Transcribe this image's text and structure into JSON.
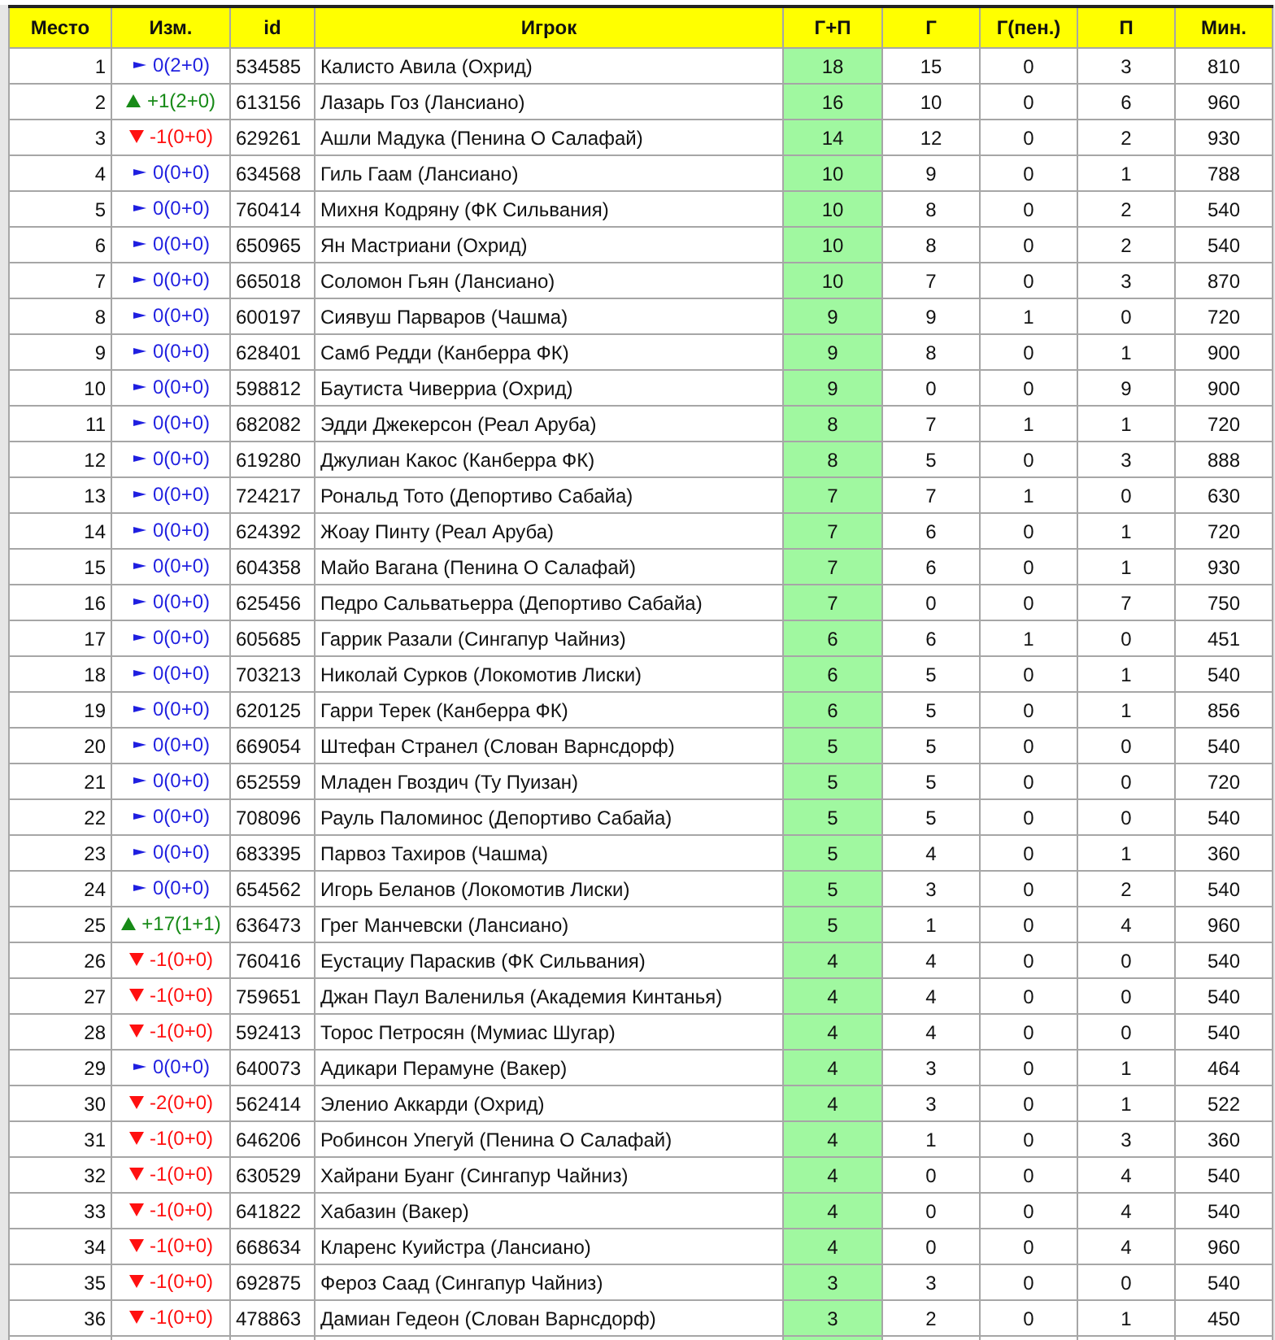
{
  "table": {
    "columns": [
      "Место",
      "Изм.",
      "id",
      "Игрок",
      "Г+П",
      "Г",
      "Г(пен.)",
      "П",
      "Мин."
    ],
    "rows": [
      {
        "place": "1",
        "change": {
          "kind": "flat",
          "text": "0(2+0)"
        },
        "id": "534585",
        "player": "Калисто Авила (Охрид)",
        "goals_assists": "18",
        "goals": "15",
        "penalty_goals": "0",
        "assists": "3",
        "minutes": "810"
      },
      {
        "place": "2",
        "change": {
          "kind": "up",
          "text": "+1(2+0)"
        },
        "id": "613156",
        "player": "Лазарь Гоз (Лансиано)",
        "goals_assists": "16",
        "goals": "10",
        "penalty_goals": "0",
        "assists": "6",
        "minutes": "960"
      },
      {
        "place": "3",
        "change": {
          "kind": "down",
          "text": "-1(0+0)"
        },
        "id": "629261",
        "player": "Ашли Мадука (Пенина О Салафай)",
        "goals_assists": "14",
        "goals": "12",
        "penalty_goals": "0",
        "assists": "2",
        "minutes": "930"
      },
      {
        "place": "4",
        "change": {
          "kind": "flat",
          "text": "0(0+0)"
        },
        "id": "634568",
        "player": "Гиль Гаам (Лансиано)",
        "goals_assists": "10",
        "goals": "9",
        "penalty_goals": "0",
        "assists": "1",
        "minutes": "788"
      },
      {
        "place": "5",
        "change": {
          "kind": "flat",
          "text": "0(0+0)"
        },
        "id": "760414",
        "player": "Михня Кодряну (ФК Сильвания)",
        "goals_assists": "10",
        "goals": "8",
        "penalty_goals": "0",
        "assists": "2",
        "minutes": "540"
      },
      {
        "place": "6",
        "change": {
          "kind": "flat",
          "text": "0(0+0)"
        },
        "id": "650965",
        "player": "Ян Мастриани (Охрид)",
        "goals_assists": "10",
        "goals": "8",
        "penalty_goals": "0",
        "assists": "2",
        "minutes": "540"
      },
      {
        "place": "7",
        "change": {
          "kind": "flat",
          "text": "0(0+0)"
        },
        "id": "665018",
        "player": "Соломон Гьян (Лансиано)",
        "goals_assists": "10",
        "goals": "7",
        "penalty_goals": "0",
        "assists": "3",
        "minutes": "870"
      },
      {
        "place": "8",
        "change": {
          "kind": "flat",
          "text": "0(0+0)"
        },
        "id": "600197",
        "player": "Сиявуш Парваров (Чашма)",
        "goals_assists": "9",
        "goals": "9",
        "penalty_goals": "1",
        "assists": "0",
        "minutes": "720"
      },
      {
        "place": "9",
        "change": {
          "kind": "flat",
          "text": "0(0+0)"
        },
        "id": "628401",
        "player": "Самб Редди (Канберра ФК)",
        "goals_assists": "9",
        "goals": "8",
        "penalty_goals": "0",
        "assists": "1",
        "minutes": "900"
      },
      {
        "place": "10",
        "change": {
          "kind": "flat",
          "text": "0(0+0)"
        },
        "id": "598812",
        "player": "Баутиста Чиверриа (Охрид)",
        "goals_assists": "9",
        "goals": "0",
        "penalty_goals": "0",
        "assists": "9",
        "minutes": "900"
      },
      {
        "place": "11",
        "change": {
          "kind": "flat",
          "text": "0(0+0)"
        },
        "id": "682082",
        "player": "Эдди Джекерсон (Реал Аруба)",
        "goals_assists": "8",
        "goals": "7",
        "penalty_goals": "1",
        "assists": "1",
        "minutes": "720"
      },
      {
        "place": "12",
        "change": {
          "kind": "flat",
          "text": "0(0+0)"
        },
        "id": "619280",
        "player": "Джулиан Какос (Канберра ФК)",
        "goals_assists": "8",
        "goals": "5",
        "penalty_goals": "0",
        "assists": "3",
        "minutes": "888"
      },
      {
        "place": "13",
        "change": {
          "kind": "flat",
          "text": "0(0+0)"
        },
        "id": "724217",
        "player": "Рональд Тото (Депортиво Сабайа)",
        "goals_assists": "7",
        "goals": "7",
        "penalty_goals": "1",
        "assists": "0",
        "minutes": "630"
      },
      {
        "place": "14",
        "change": {
          "kind": "flat",
          "text": "0(0+0)"
        },
        "id": "624392",
        "player": "Жоау Пинту (Реал Аруба)",
        "goals_assists": "7",
        "goals": "6",
        "penalty_goals": "0",
        "assists": "1",
        "minutes": "720"
      },
      {
        "place": "15",
        "change": {
          "kind": "flat",
          "text": "0(0+0)"
        },
        "id": "604358",
        "player": "Майо Вагана (Пенина О Салафай)",
        "goals_assists": "7",
        "goals": "6",
        "penalty_goals": "0",
        "assists": "1",
        "minutes": "930"
      },
      {
        "place": "16",
        "change": {
          "kind": "flat",
          "text": "0(0+0)"
        },
        "id": "625456",
        "player": "Педро Сальватьерра (Депортиво Сабайа)",
        "goals_assists": "7",
        "goals": "0",
        "penalty_goals": "0",
        "assists": "7",
        "minutes": "750"
      },
      {
        "place": "17",
        "change": {
          "kind": "flat",
          "text": "0(0+0)"
        },
        "id": "605685",
        "player": "Гаррик Разали (Сингапур Чайниз)",
        "goals_assists": "6",
        "goals": "6",
        "penalty_goals": "1",
        "assists": "0",
        "minutes": "451"
      },
      {
        "place": "18",
        "change": {
          "kind": "flat",
          "text": "0(0+0)"
        },
        "id": "703213",
        "player": "Николай Сурков (Локомотив Лиски)",
        "goals_assists": "6",
        "goals": "5",
        "penalty_goals": "0",
        "assists": "1",
        "minutes": "540"
      },
      {
        "place": "19",
        "change": {
          "kind": "flat",
          "text": "0(0+0)"
        },
        "id": "620125",
        "player": "Гарри Терек (Канберра ФК)",
        "goals_assists": "6",
        "goals": "5",
        "penalty_goals": "0",
        "assists": "1",
        "minutes": "856"
      },
      {
        "place": "20",
        "change": {
          "kind": "flat",
          "text": "0(0+0)"
        },
        "id": "669054",
        "player": "Штефан Странел (Слован Варнсдорф)",
        "goals_assists": "5",
        "goals": "5",
        "penalty_goals": "0",
        "assists": "0",
        "minutes": "540"
      },
      {
        "place": "21",
        "change": {
          "kind": "flat",
          "text": "0(0+0)"
        },
        "id": "652559",
        "player": "Младен Гвоздич (Ту Пуизан)",
        "goals_assists": "5",
        "goals": "5",
        "penalty_goals": "0",
        "assists": "0",
        "minutes": "720"
      },
      {
        "place": "22",
        "change": {
          "kind": "flat",
          "text": "0(0+0)"
        },
        "id": "708096",
        "player": "Рауль Паломинос (Депортиво Сабайа)",
        "goals_assists": "5",
        "goals": "5",
        "penalty_goals": "0",
        "assists": "0",
        "minutes": "540"
      },
      {
        "place": "23",
        "change": {
          "kind": "flat",
          "text": "0(0+0)"
        },
        "id": "683395",
        "player": "Парвоз Тахиров (Чашма)",
        "goals_assists": "5",
        "goals": "4",
        "penalty_goals": "0",
        "assists": "1",
        "minutes": "360"
      },
      {
        "place": "24",
        "change": {
          "kind": "flat",
          "text": "0(0+0)"
        },
        "id": "654562",
        "player": "Игорь Беланов (Локомотив Лиски)",
        "goals_assists": "5",
        "goals": "3",
        "penalty_goals": "0",
        "assists": "2",
        "minutes": "540"
      },
      {
        "place": "25",
        "change": {
          "kind": "up",
          "text": "+17(1+1)"
        },
        "id": "636473",
        "player": "Грег Манчевски (Лансиано)",
        "goals_assists": "5",
        "goals": "1",
        "penalty_goals": "0",
        "assists": "4",
        "minutes": "960"
      },
      {
        "place": "26",
        "change": {
          "kind": "down",
          "text": "-1(0+0)"
        },
        "id": "760416",
        "player": "Еустациу Параскив (ФК Сильвания)",
        "goals_assists": "4",
        "goals": "4",
        "penalty_goals": "0",
        "assists": "0",
        "minutes": "540"
      },
      {
        "place": "27",
        "change": {
          "kind": "down",
          "text": "-1(0+0)"
        },
        "id": "759651",
        "player": "Джан Паул Валенилья (Академия Кинтанья)",
        "goals_assists": "4",
        "goals": "4",
        "penalty_goals": "0",
        "assists": "0",
        "minutes": "540"
      },
      {
        "place": "28",
        "change": {
          "kind": "down",
          "text": "-1(0+0)"
        },
        "id": "592413",
        "player": "Торос Петросян (Мумиас Шугар)",
        "goals_assists": "4",
        "goals": "4",
        "penalty_goals": "0",
        "assists": "0",
        "minutes": "540"
      },
      {
        "place": "29",
        "change": {
          "kind": "flat",
          "text": "0(0+0)"
        },
        "id": "640073",
        "player": "Адикари Перамуне (Вакер)",
        "goals_assists": "4",
        "goals": "3",
        "penalty_goals": "0",
        "assists": "1",
        "minutes": "464"
      },
      {
        "place": "30",
        "change": {
          "kind": "down",
          "text": "-2(0+0)"
        },
        "id": "562414",
        "player": "Эленио Аккарди (Охрид)",
        "goals_assists": "4",
        "goals": "3",
        "penalty_goals": "0",
        "assists": "1",
        "minutes": "522"
      },
      {
        "place": "31",
        "change": {
          "kind": "down",
          "text": "-1(0+0)"
        },
        "id": "646206",
        "player": "Робинсон Упегуй (Пенина О Салафай)",
        "goals_assists": "4",
        "goals": "1",
        "penalty_goals": "0",
        "assists": "3",
        "minutes": "360"
      },
      {
        "place": "32",
        "change": {
          "kind": "down",
          "text": "-1(0+0)"
        },
        "id": "630529",
        "player": "Хайрани Буанг (Сингапур Чайниз)",
        "goals_assists": "4",
        "goals": "0",
        "penalty_goals": "0",
        "assists": "4",
        "minutes": "540"
      },
      {
        "place": "33",
        "change": {
          "kind": "down",
          "text": "-1(0+0)"
        },
        "id": "641822",
        "player": "Хабазин (Вакер)",
        "goals_assists": "4",
        "goals": "0",
        "penalty_goals": "0",
        "assists": "4",
        "minutes": "540"
      },
      {
        "place": "34",
        "change": {
          "kind": "down",
          "text": "-1(0+0)"
        },
        "id": "668634",
        "player": "Кларенс Куийстра (Лансиано)",
        "goals_assists": "4",
        "goals": "0",
        "penalty_goals": "0",
        "assists": "4",
        "minutes": "960"
      },
      {
        "place": "35",
        "change": {
          "kind": "down",
          "text": "-1(0+0)"
        },
        "id": "692875",
        "player": "Фероз Саад (Сингапур Чайниз)",
        "goals_assists": "3",
        "goals": "3",
        "penalty_goals": "0",
        "assists": "0",
        "minutes": "540"
      },
      {
        "place": "36",
        "change": {
          "kind": "down",
          "text": "-1(0+0)"
        },
        "id": "478863",
        "player": "Дамиан Гедеон (Слован Варнсдорф)",
        "goals_assists": "3",
        "goals": "2",
        "penalty_goals": "0",
        "assists": "1",
        "minutes": "450"
      }
    ]
  }
}
